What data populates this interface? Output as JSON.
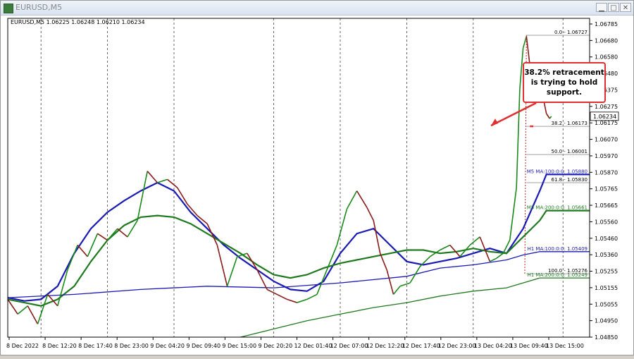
{
  "window": {
    "title": "EURUSD,M5"
  },
  "chart_data": {
    "type": "line",
    "symbol_info": "EURUSD,M5  1.06225 1.06248 1.06210 1.06234",
    "current_price_label": "1.06234",
    "current_price": 1.06234,
    "ylim": [
      1.0489,
      1.0683
    ],
    "y_ticks": [
      "1.06785",
      "1.06680",
      "1.06580",
      "1.06480",
      "1.06375",
      "1.06275",
      "1.06175",
      "1.06070",
      "1.05970",
      "1.05870",
      "1.05765",
      "1.05665",
      "1.05560",
      "1.05460",
      "1.05360",
      "1.05255",
      "1.05155",
      "1.05055",
      "1.04950",
      "1.04850"
    ],
    "x_ticks": [
      "8 Dec 2022",
      "8 Dec 12:20",
      "8 Dec 17:40",
      "8 Dec 23:00",
      "9 Dec 04:20",
      "9 Dec 09:40",
      "9 Dec 15:00",
      "9 Dec 20:20",
      "12 Dec 01:40",
      "12 Dec 07:00",
      "12 Dec 12:20",
      "12 Dec 17:40",
      "12 Dec 23:00",
      "13 Dec 04:20",
      "13 Dec 09:40",
      "13 Dec 15:00"
    ],
    "period_separators": [
      1.0,
      3.0,
      5.0,
      8.0,
      10.0,
      12.0,
      14.0,
      16.7
    ],
    "price_path": [
      [
        0.0,
        1.0512
      ],
      [
        0.3,
        1.0503
      ],
      [
        0.6,
        1.0508
      ],
      [
        0.9,
        1.0497
      ],
      [
        1.2,
        1.0515
      ],
      [
        1.5,
        1.0508
      ],
      [
        1.8,
        1.053
      ],
      [
        2.1,
        1.0545
      ],
      [
        2.4,
        1.0538
      ],
      [
        2.7,
        1.0552
      ],
      [
        3.0,
        1.0548
      ],
      [
        3.3,
        1.0555
      ],
      [
        3.6,
        1.055
      ],
      [
        3.9,
        1.056
      ],
      [
        4.2,
        1.059
      ],
      [
        4.5,
        1.0583
      ],
      [
        4.8,
        1.0585
      ],
      [
        5.1,
        1.058
      ],
      [
        5.4,
        1.057
      ],
      [
        5.7,
        1.0563
      ],
      [
        6.0,
        1.0558
      ],
      [
        6.3,
        1.0545
      ],
      [
        6.6,
        1.052
      ],
      [
        6.9,
        1.0538
      ],
      [
        7.2,
        1.054
      ],
      [
        7.5,
        1.053
      ],
      [
        7.8,
        1.0518
      ],
      [
        8.1,
        1.0515
      ],
      [
        8.4,
        1.0512
      ],
      [
        8.7,
        1.051
      ],
      [
        9.0,
        1.0512
      ],
      [
        9.3,
        1.0515
      ],
      [
        9.6,
        1.053
      ],
      [
        9.9,
        1.0545
      ],
      [
        10.2,
        1.0567
      ],
      [
        10.5,
        1.0578
      ],
      [
        10.8,
        1.0568
      ],
      [
        11.0,
        1.056
      ],
      [
        11.2,
        1.054
      ],
      [
        11.4,
        1.053
      ],
      [
        11.6,
        1.0515
      ],
      [
        11.8,
        1.052
      ],
      [
        12.1,
        1.0522
      ],
      [
        12.4,
        1.0532
      ],
      [
        12.7,
        1.0538
      ],
      [
        13.0,
        1.0542
      ],
      [
        13.3,
        1.0545
      ],
      [
        13.6,
        1.0538
      ],
      [
        13.9,
        1.0545
      ],
      [
        14.2,
        1.055
      ],
      [
        14.5,
        1.0535
      ],
      [
        14.7,
        1.0537
      ],
      [
        14.9,
        1.054
      ],
      [
        15.1,
        1.0548
      ],
      [
        15.3,
        1.058
      ],
      [
        15.4,
        1.064
      ],
      [
        15.5,
        1.0665
      ],
      [
        15.6,
        1.0672
      ],
      [
        15.7,
        1.0655
      ],
      [
        15.8,
        1.064
      ],
      [
        15.95,
        1.065
      ],
      [
        16.1,
        1.0635
      ],
      [
        16.2,
        1.0625
      ],
      [
        16.3,
        1.0622
      ],
      [
        16.35,
        1.06234
      ]
    ],
    "series": [
      {
        "name": "M5 MA:100:0:0:  1.05880",
        "color": "#1a1ab4",
        "values": [
          [
            0.0,
            1.0513
          ],
          [
            0.5,
            1.0511
          ],
          [
            1.0,
            1.0512
          ],
          [
            1.5,
            1.052
          ],
          [
            2.0,
            1.054
          ],
          [
            2.5,
            1.0555
          ],
          [
            3.0,
            1.0565
          ],
          [
            3.5,
            1.0572
          ],
          [
            4.0,
            1.0578
          ],
          [
            4.5,
            1.0583
          ],
          [
            5.0,
            1.0578
          ],
          [
            5.5,
            1.0565
          ],
          [
            6.0,
            1.0555
          ],
          [
            6.5,
            1.0545
          ],
          [
            7.0,
            1.0537
          ],
          [
            7.5,
            1.053
          ],
          [
            8.0,
            1.0523
          ],
          [
            8.5,
            1.0518
          ],
          [
            9.0,
            1.0517
          ],
          [
            9.5,
            1.0523
          ],
          [
            10.0,
            1.054
          ],
          [
            10.5,
            1.0552
          ],
          [
            11.0,
            1.0555
          ],
          [
            11.5,
            1.0545
          ],
          [
            12.0,
            1.0535
          ],
          [
            12.5,
            1.0533
          ],
          [
            13.0,
            1.0535
          ],
          [
            13.5,
            1.0537
          ],
          [
            14.0,
            1.054
          ],
          [
            14.5,
            1.0543
          ],
          [
            15.0,
            1.054
          ],
          [
            15.5,
            1.0555
          ],
          [
            16.0,
            1.0578
          ],
          [
            16.2,
            1.0588
          ],
          [
            17.5,
            1.0588
          ]
        ]
      },
      {
        "name": "M5 MA:200:0:0:  1.05661",
        "color": "#1f7a1f",
        "values": [
          [
            0.0,
            1.0512
          ],
          [
            0.5,
            1.051
          ],
          [
            1.0,
            1.0508
          ],
          [
            1.5,
            1.0512
          ],
          [
            2.0,
            1.052
          ],
          [
            2.5,
            1.0535
          ],
          [
            3.0,
            1.0548
          ],
          [
            3.5,
            1.0557
          ],
          [
            4.0,
            1.0562
          ],
          [
            4.5,
            1.0563
          ],
          [
            5.0,
            1.0562
          ],
          [
            5.5,
            1.0558
          ],
          [
            6.0,
            1.0552
          ],
          [
            6.5,
            1.0546
          ],
          [
            7.0,
            1.054
          ],
          [
            7.5,
            1.0533
          ],
          [
            8.0,
            1.0527
          ],
          [
            8.5,
            1.0525
          ],
          [
            9.0,
            1.0527
          ],
          [
            9.5,
            1.0531
          ],
          [
            10.0,
            1.0534
          ],
          [
            10.5,
            1.0536
          ],
          [
            11.0,
            1.0538
          ],
          [
            11.5,
            1.054
          ],
          [
            12.0,
            1.0542
          ],
          [
            12.5,
            1.0542
          ],
          [
            13.0,
            1.054
          ],
          [
            13.5,
            1.0541
          ],
          [
            14.0,
            1.0543
          ],
          [
            14.5,
            1.0541
          ],
          [
            15.0,
            1.054
          ],
          [
            15.5,
            1.055
          ],
          [
            16.0,
            1.056
          ],
          [
            16.2,
            1.0566
          ],
          [
            17.5,
            1.0566
          ]
        ]
      },
      {
        "name": "H1 MA:100:0:0:  1.05409",
        "color": "#1a1ab4",
        "values": [
          [
            0.0,
            1.0513
          ],
          [
            2.0,
            1.0515
          ],
          [
            4.0,
            1.0518
          ],
          [
            6.0,
            1.052
          ],
          [
            8.0,
            1.0519
          ],
          [
            10.0,
            1.0522
          ],
          [
            12.0,
            1.0526
          ],
          [
            13.0,
            1.0531
          ],
          [
            14.0,
            1.0533
          ],
          [
            15.0,
            1.0536
          ],
          [
            15.5,
            1.0539
          ],
          [
            16.0,
            1.0541
          ],
          [
            17.5,
            1.0541
          ]
        ]
      },
      {
        "name": "H1 MA:200:0:0:  1.05249",
        "color": "#1f7a1f",
        "values": [
          [
            7.0,
            1.0489
          ],
          [
            8.0,
            1.0494
          ],
          [
            9.0,
            1.0499
          ],
          [
            10.0,
            1.0503
          ],
          [
            11.0,
            1.0507
          ],
          [
            12.0,
            1.051
          ],
          [
            13.0,
            1.0514
          ],
          [
            14.0,
            1.0517
          ],
          [
            15.0,
            1.0519
          ],
          [
            15.5,
            1.0522
          ],
          [
            16.0,
            1.0525
          ],
          [
            17.5,
            1.0525
          ]
        ]
      }
    ],
    "fibonacci": {
      "color": "#a0a0a0",
      "x_start": 15.6,
      "levels": [
        {
          "label": "0.0 - 1.06727",
          "value": 1.06727
        },
        {
          "label": "38.2 - 1.06173",
          "value": 1.06173
        },
        {
          "label": "50.0 - 1.06001",
          "value": 1.06001
        },
        {
          "label": "61.8 - 1.05830",
          "value": 1.0583
        },
        {
          "label": "100.0 - 1.05276",
          "value": 1.05276
        }
      ],
      "trend_line": [
        [
          15.55,
          1.05276
        ],
        [
          15.6,
          1.06727
        ]
      ]
    },
    "annotation": {
      "text_lines": [
        "38.2% retracement",
        "is trying to hold",
        "support."
      ],
      "border_color": "#e03030",
      "highlight_level": 1.06173
    },
    "colors": {
      "price": "#1a8a1a",
      "price_down": "#8b1a1a",
      "background": "#ffffff",
      "grid": "#000000",
      "axis_text": "#000000"
    }
  }
}
